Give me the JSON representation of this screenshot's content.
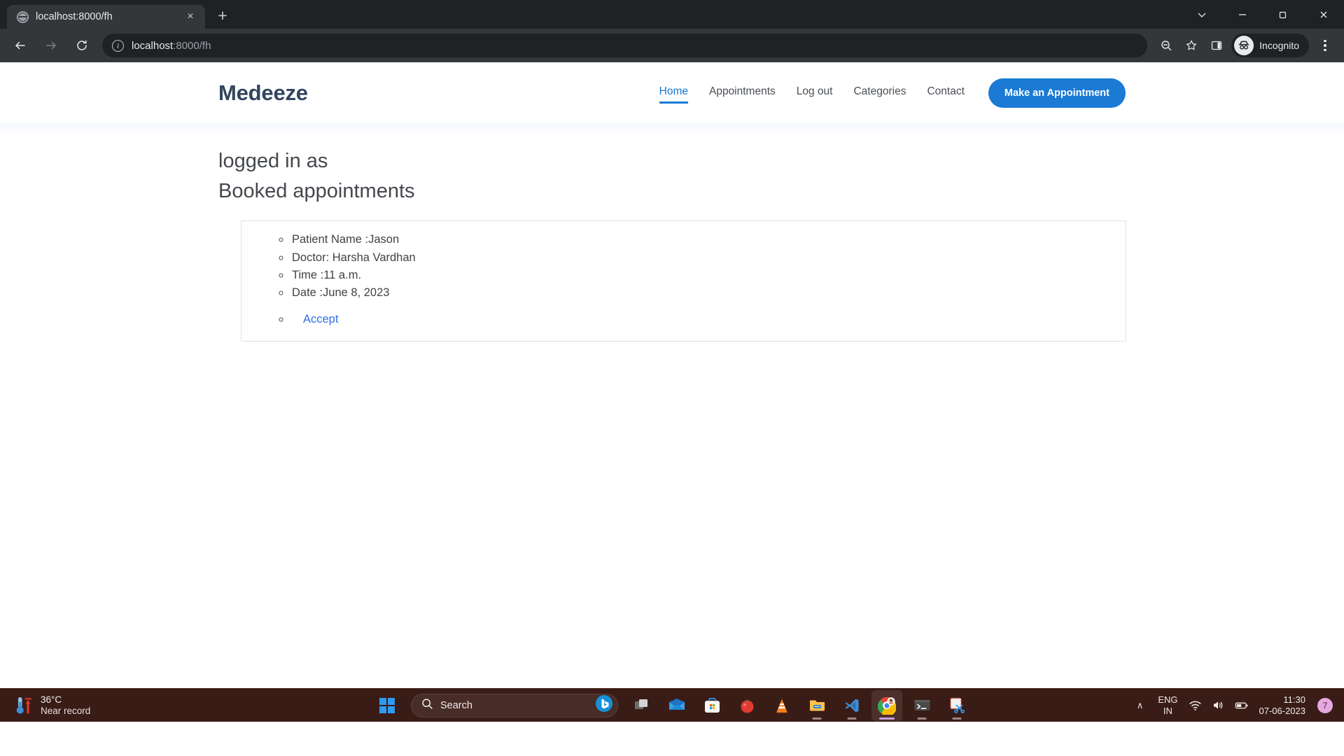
{
  "browser": {
    "tab": {
      "title": "localhost:8000/fh",
      "favicon": "globe-icon",
      "close": "×"
    },
    "newtab_label": "+",
    "window_controls": {
      "minimize": "—",
      "maximize": "❐",
      "close": "✕",
      "chevron": "⌄"
    },
    "nav": {
      "back": "←",
      "forward": "→",
      "reload": "⟳"
    },
    "omnibox": {
      "info_icon": "info-icon",
      "url_host": "localhost",
      "url_rest": ":8000/fh"
    },
    "actions": {
      "zoom_icon": "zoom-out-icon",
      "bookmark_icon": "star-icon",
      "sidepanel_icon": "side-panel-icon",
      "profile_label": "Incognito",
      "menu_icon": "three-dot-menu-icon"
    }
  },
  "site": {
    "brand": "Medeeze",
    "nav_items": [
      {
        "label": "Home",
        "active": true
      },
      {
        "label": "Appointments",
        "active": false
      },
      {
        "label": "Log out",
        "active": false
      },
      {
        "label": "Categories",
        "active": false
      },
      {
        "label": "Contact",
        "active": false
      }
    ],
    "cta_label": "Make an Appointment",
    "accent_color": "#1a7ad4",
    "brand_color": "#31455e"
  },
  "main": {
    "logged_in_heading": "logged in as",
    "booked_heading": "Booked appointments",
    "appointment": {
      "patient": "Patient Name :Jason",
      "doctor": "Doctor: Harsha Vardhan",
      "time": "Time :11 a.m.",
      "date": "Date :June 8, 2023",
      "accept_label": "Accept",
      "link_color": "#2f6fe4"
    }
  },
  "taskbar": {
    "weather": {
      "temperature": "36°C",
      "description": "Near record",
      "icon": "thermometer-icon"
    },
    "start_icon": "windows-start-icon",
    "search": {
      "placeholder": "Search",
      "icon": "search-icon",
      "bing_icon": "bing-chat-icon"
    },
    "apps": [
      {
        "name": "task-view-icon",
        "running": false
      },
      {
        "name": "mail-icon",
        "running": false
      },
      {
        "name": "microsoft-store-icon",
        "running": false
      },
      {
        "name": "tomato-timer-icon",
        "running": false
      },
      {
        "name": "vlc-icon",
        "running": false
      },
      {
        "name": "file-explorer-icon",
        "running": true
      },
      {
        "name": "vs-code-icon",
        "running": true
      },
      {
        "name": "google-chrome-icon",
        "running": true,
        "focused": true
      },
      {
        "name": "terminal-icon",
        "running": true
      },
      {
        "name": "snipping-tool-icon",
        "running": true
      }
    ],
    "tray": {
      "chevron": "∧",
      "language_line1": "ENG",
      "language_line2": "IN",
      "wifi_icon": "wifi-icon",
      "volume_icon": "speaker-icon",
      "battery_icon": "battery-icon",
      "time": "11:30",
      "date": "07-06-2023",
      "notification_count": "7"
    }
  }
}
